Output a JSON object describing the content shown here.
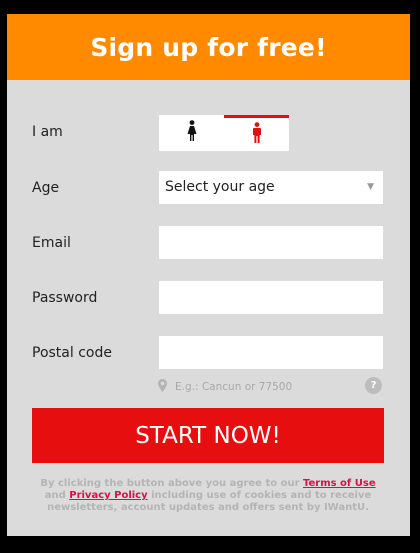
{
  "header": {
    "title": "Sign up for free!"
  },
  "form": {
    "gender_label": "I am",
    "age_label": "Age",
    "age_select_value": "Select your age",
    "email_label": "Email",
    "password_label": "Password",
    "postal_label": "Postal code",
    "postal_hint": "E.g.: Cancun or 77500",
    "help_glyph": "?"
  },
  "cta": {
    "label": "START NOW!"
  },
  "legal": {
    "prefix": "By clicking the button above you agree to our",
    "terms_link": "Terms of Use",
    "and": "and",
    "privacy_link": "Privacy Policy",
    "suffix": "including use of cookies and to receive newsletters, account updates and offers sent by IWantU."
  },
  "colors": {
    "brand_orange": "#ff8a00",
    "cta_red": "#e60e0e",
    "active_gender": "#e10f0f",
    "link": "#d5114a"
  }
}
